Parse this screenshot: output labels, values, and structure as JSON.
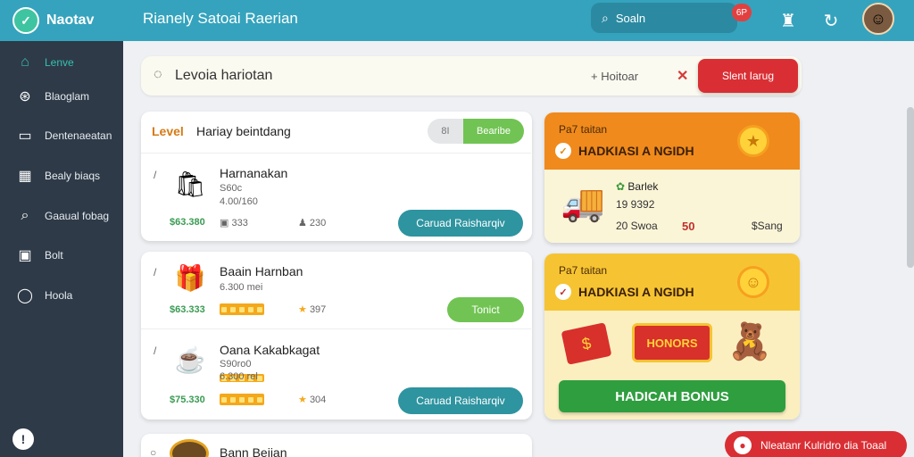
{
  "app": {
    "name": "Naotav",
    "page_title": "Rianely Satoai Raerian"
  },
  "topbar": {
    "search_label": "Soaln",
    "notification_badge": "6P"
  },
  "sidebar": {
    "items": [
      {
        "label": "Lenve",
        "icon": "home-icon",
        "active": true
      },
      {
        "label": "Blaoglam",
        "icon": "cycle-icon"
      },
      {
        "label": "Dentenaeatan",
        "icon": "monitor-icon"
      },
      {
        "label": "Bealy biaqs",
        "icon": "grid-icon"
      },
      {
        "label": "Gaaual fobag",
        "icon": "search-icon"
      },
      {
        "label": "Bolt",
        "icon": "calendar-icon"
      },
      {
        "label": "Hoola",
        "icon": "circle-icon"
      }
    ]
  },
  "filter": {
    "query": "Levoia hariotan",
    "alt_label": "+ Hoitoar",
    "action": "Slent Iarug"
  },
  "listing": {
    "level_label": "Level",
    "title": "Hariay beintdang",
    "toggle_off": "8I",
    "toggle_on": "Bearibe",
    "items": [
      {
        "name": "Harnanakan",
        "sub1": "S60c",
        "sub2": "4.00/160",
        "price": "$63.380",
        "stat1": "333",
        "stat2": "230",
        "action": "Caruad Raisharqiv",
        "icon": "gift-bag-icon"
      },
      {
        "name": "Baain Harnban",
        "sub1": "6.300 mei",
        "price": "$63.333",
        "rating": "397",
        "action": "Tonict",
        "icon": "gift-box-icon"
      },
      {
        "name": "Oana Kakabkagat",
        "sub1": "S90ro0",
        "sub2": "6.300 rel",
        "price": "$75.330",
        "rating": "304",
        "action": "Caruad Raisharqiv",
        "icon": "mug-icon"
      },
      {
        "name": "Bann Beiian",
        "icon": "crate-icon"
      }
    ]
  },
  "promos": [
    {
      "sup": "Pa7 taitan",
      "title": "HADKIASI A NGIDH",
      "body_title": "Barlek",
      "body_value": "19 9392",
      "stat1": "20 Swoa",
      "stat2": "50",
      "stat3": "$Sang"
    },
    {
      "sup": "Pa7 taitan",
      "title": "HADKIASI A NGIDH",
      "banner_text": "HONORS",
      "button": "HADICAH BONUS"
    }
  ],
  "toast": {
    "text": "Nleatanr Kulridro dia Toaal"
  },
  "colors": {
    "primary": "#35a3bd",
    "sidebar": "#2e3a48",
    "danger": "#d92f34",
    "success": "#71c453",
    "teal_button": "#2e94a0",
    "promo_orange": "#f08a1c",
    "promo_yellow": "#f6c432"
  }
}
